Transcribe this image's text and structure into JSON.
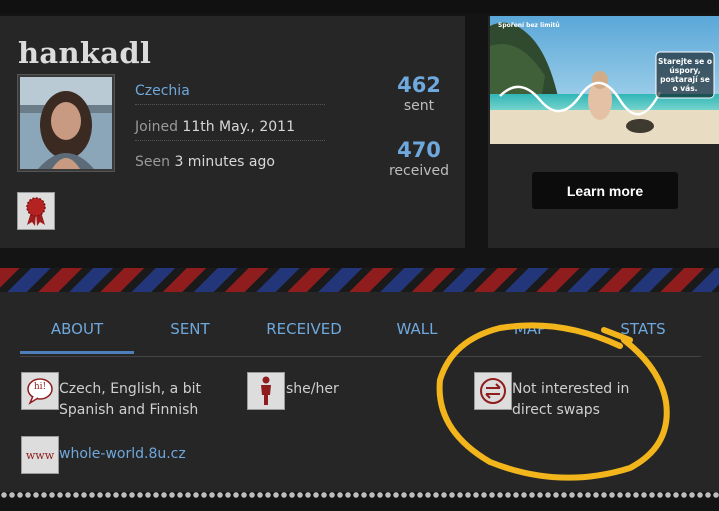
{
  "profile": {
    "username": "hankadl",
    "country": "Czechia",
    "joined_label": "Joined",
    "joined_date": "11th May., 2011",
    "seen_label": "Seen",
    "seen_value": "3 minutes ago",
    "sent_count": "462",
    "sent_label": "sent",
    "received_count": "470",
    "received_label": "received"
  },
  "ad": {
    "header_text": "Spoření bez limitů",
    "overlay_text": "Starejte se o úspory, postarají se o vás.",
    "cta_label": "Learn more"
  },
  "tabs": [
    {
      "label": "ABOUT"
    },
    {
      "label": "SENT"
    },
    {
      "label": "RECEIVED"
    },
    {
      "label": "WALL"
    },
    {
      "label": "MAP"
    },
    {
      "label": "STATS"
    }
  ],
  "about": {
    "languages": "Czech, English, a bit Spanish and Finnish",
    "languages_icon_text": "hi!",
    "pronouns": "she/her",
    "swaps": "Not interested in direct swaps",
    "website_icon_text": "www",
    "website": "whole-world.8u.cz"
  },
  "colors": {
    "accent": "#6fa8dc",
    "annotation": "#f2b51c",
    "badge_red": "#a01c1c"
  }
}
